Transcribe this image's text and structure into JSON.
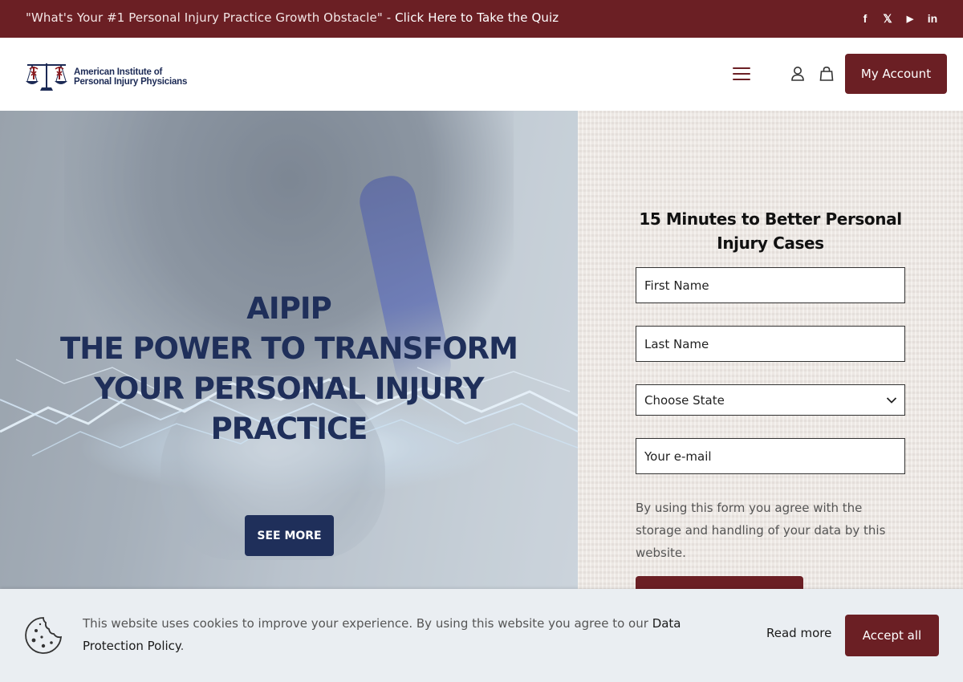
{
  "topbar": {
    "promo_prefix": "\"What's Your #1 Personal Injury Practice Growth Obstacle\" - ",
    "promo_link": "Click Here to Take the Quiz",
    "social": [
      "f",
      "𝕏",
      "▶",
      "in"
    ]
  },
  "header": {
    "logo_line1": "American Institute of",
    "logo_line2": "Personal Injury Physicians",
    "account_label": "My Account",
    "icons": [
      "menu-icon",
      "user-icon",
      "bag-icon"
    ]
  },
  "hero": {
    "line1": "AIPIP",
    "line2": "THE POWER TO TRANSFORM",
    "line3": "YOUR PERSONAL INJURY",
    "line4": "PRACTICE",
    "button_label": "SEE MORE"
  },
  "form": {
    "title": "15 Minutes to Better Personal Injury Cases",
    "first_name_placeholder": "First Name",
    "last_name_placeholder": "Last Name",
    "state_selected": "Choose State",
    "email_placeholder": "Your e-mail",
    "consent": "By using this form you agree with the storage and handling of your data by this website."
  },
  "cookie": {
    "text": "This website uses cookies to improve your experience. By using this website you agree to our ",
    "policy_link": "Data Protection Policy",
    "text_end": ".",
    "read_more": "Read more",
    "accept": "Accept all"
  },
  "colors": {
    "brand": "#6b1f24",
    "navy": "#1f2f5a",
    "cookie_bg": "#eaeef2"
  }
}
